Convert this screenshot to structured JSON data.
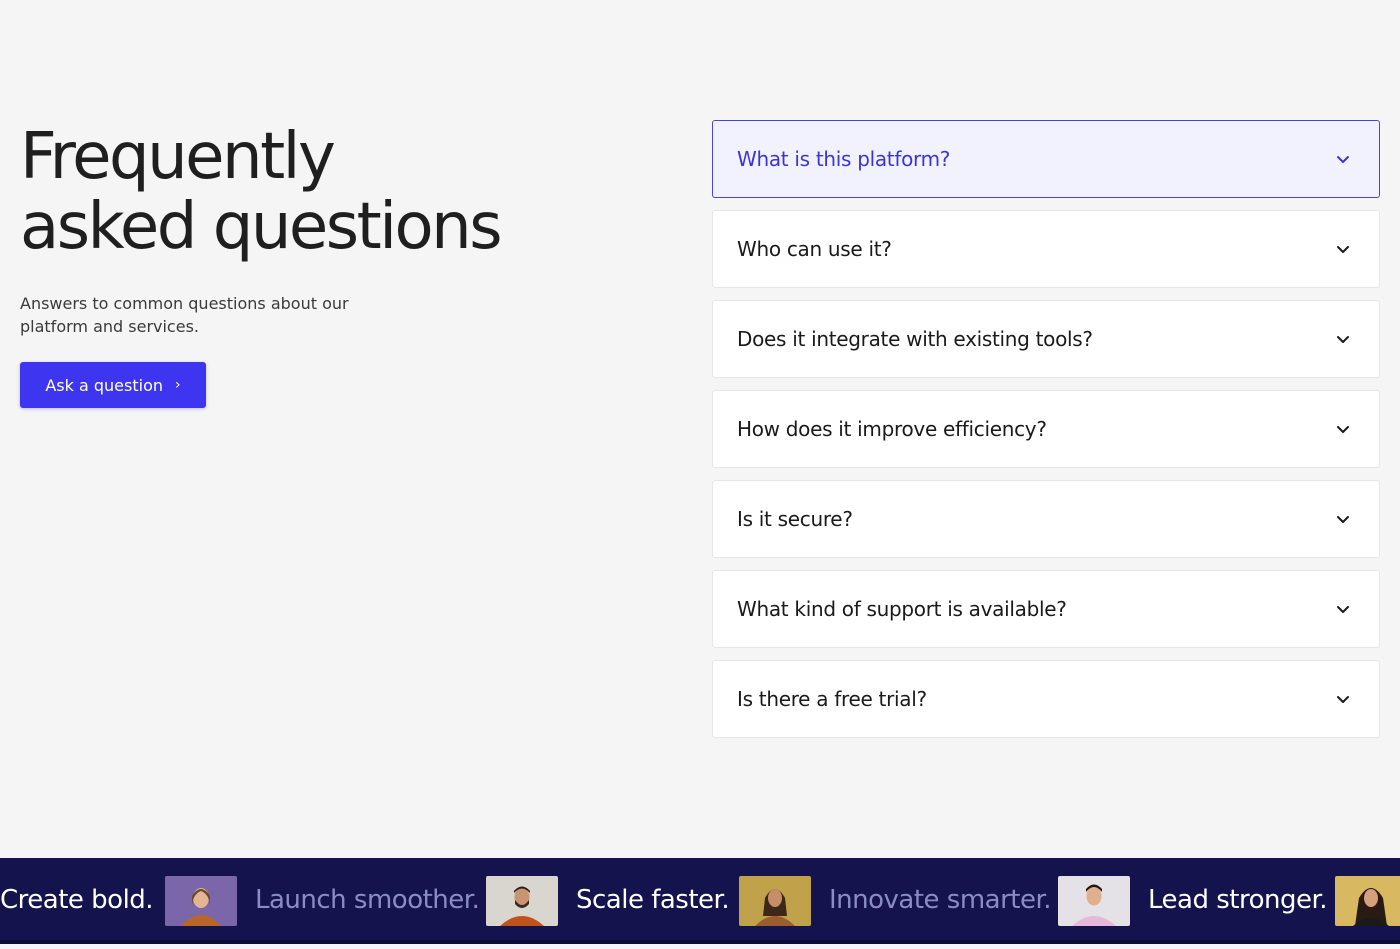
{
  "hero": {
    "title_line1": "Frequently",
    "title_line2": "asked questions",
    "subtitle": "Answers to common questions about our platform and services.",
    "cta_label": "Ask a question"
  },
  "faq": [
    {
      "question": "What is this platform?",
      "expanded": true
    },
    {
      "question": "Who can use it?",
      "expanded": false
    },
    {
      "question": "Does it integrate with existing tools?",
      "expanded": false
    },
    {
      "question": "How does it improve efficiency?",
      "expanded": false
    },
    {
      "question": "Is it secure?",
      "expanded": false
    },
    {
      "question": "What kind of support is available?",
      "expanded": false
    },
    {
      "question": "Is there a free trial?",
      "expanded": false
    }
  ],
  "marquee": {
    "words": [
      {
        "text": "Create bold.",
        "style": "bright"
      },
      {
        "text": "Launch smoother.",
        "style": "dim"
      },
      {
        "text": "Scale faster.",
        "style": "bright"
      },
      {
        "text": "Innovate smarter.",
        "style": "dim"
      },
      {
        "text": "Lead stronger.",
        "style": "bright"
      }
    ],
    "photos": [
      "avatar-photo-woman-1",
      "avatar-photo-man-1",
      "avatar-photo-woman-2",
      "avatar-photo-man-2",
      "avatar-photo-woman-3"
    ]
  },
  "colors": {
    "accent": "#3d35f0",
    "accent_text": "#3b34d6",
    "active_bg": "#f1f2fd",
    "marquee_bg": "#14134d",
    "page_bg": "#f5f5f5"
  }
}
